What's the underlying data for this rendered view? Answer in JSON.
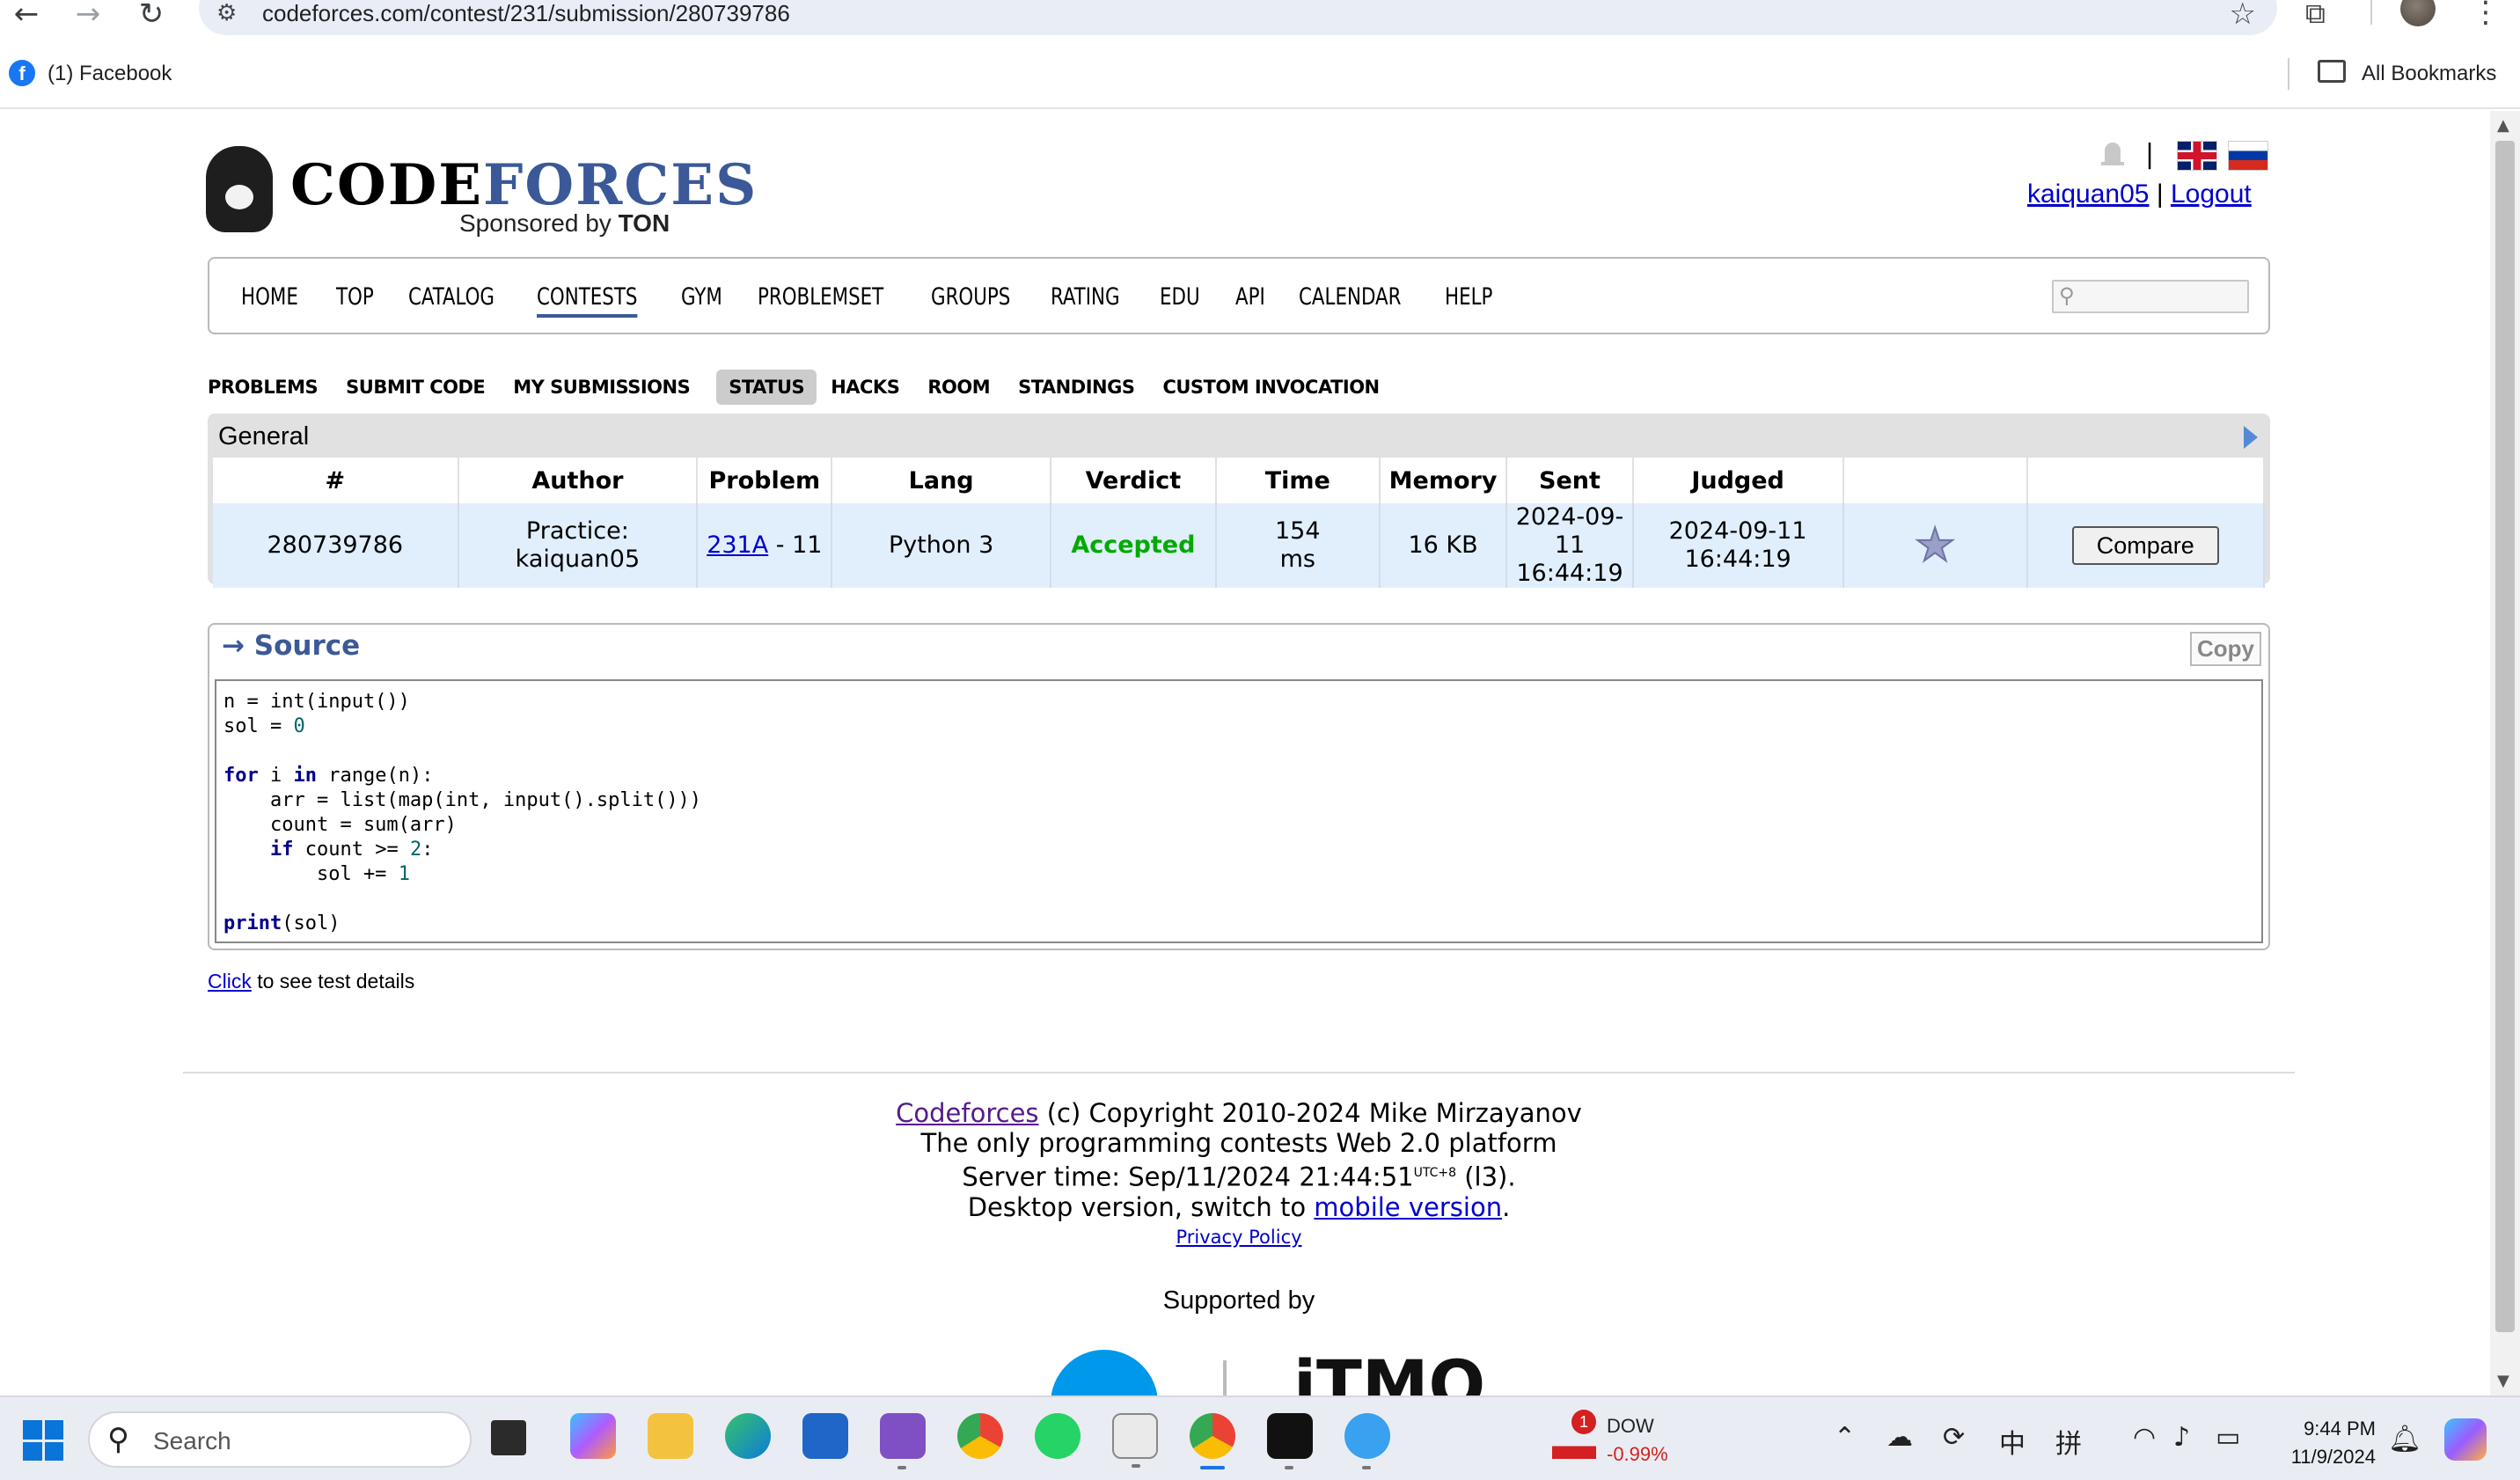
{
  "browser": {
    "url": "codeforces.com/contest/231/submission/280739786",
    "bookmark_label": "(1) Facebook",
    "all_bookmarks": "All Bookmarks"
  },
  "header": {
    "logo_code": "CODE",
    "logo_forces": "FORCES",
    "sponsored_prefix": "Sponsored by",
    "sponsored_brand": "TON",
    "username": "kaiquan05",
    "separator": "|",
    "logout": "Logout"
  },
  "main_menu": [
    "HOME",
    "TOP",
    "CATALOG",
    "CONTESTS",
    "GYM",
    "PROBLEMSET",
    "GROUPS",
    "RATING",
    "EDU",
    "API",
    "CALENDAR",
    "HELP"
  ],
  "main_menu_active": "CONTESTS",
  "second_menu": [
    "PROBLEMS",
    "SUBMIT CODE",
    "MY SUBMISSIONS",
    "STATUS",
    "HACKS",
    "ROOM",
    "STANDINGS",
    "CUSTOM INVOCATION"
  ],
  "second_menu_active": "STATUS",
  "status": {
    "title": "General",
    "columns": [
      "#",
      "Author",
      "Problem",
      "Lang",
      "Verdict",
      "Time",
      "Memory",
      "Sent",
      "Judged",
      "",
      ""
    ],
    "row": {
      "id": "280739786",
      "author_line1": "Practice:",
      "author_line2": "kaiquan05",
      "problem_link": "231A",
      "problem_suffix": " - 11",
      "lang": "Python 3",
      "verdict": "Accepted",
      "time_line1": "154",
      "time_line2": "ms",
      "memory": "16 KB",
      "sent_date": "2024-09-11",
      "sent_time": "16:44:19",
      "judged_date": "2024-09-11",
      "judged_time": "16:44:19",
      "favourite_icon": "star-icon",
      "compare": "Compare"
    }
  },
  "source": {
    "title": "→ Source",
    "copy": "Copy",
    "code": [
      "n = int(input())",
      "sol = 0",
      "",
      "for i in range(n):",
      "    arr = list(map(int, input().split()))",
      "    count = sum(arr)",
      "    if count >= 2:",
      "        sol += 1",
      "",
      "print(sol)"
    ]
  },
  "test_details": {
    "link": "Click",
    "text": " to see test details"
  },
  "footer": {
    "codeforces_link": "Codeforces",
    "copyright": " (c) Copyright 2010-2024 Mike Mirzayanov",
    "line2": "The only programming contests Web 2.0 platform",
    "server_time_prefix": "Server time: Sep/11/2024 21:44:51",
    "server_time_tz": "UTC+8",
    "server_time_suffix": " (l3).",
    "desktop_prefix": "Desktop version, switch to ",
    "mobile_link": "mobile version",
    "desktop_suffix": ".",
    "privacy": "Privacy Policy",
    "supported_by": "Supported by",
    "itmo": "iTMO"
  },
  "taskbar": {
    "search_label": "Search",
    "dow_label": "DOW",
    "dow_value": "-0.99%",
    "dow_badge": "1",
    "ime_chinese": "中",
    "ime_pinyin": "拼",
    "time": "9:44 PM",
    "date": "11/9/2024"
  },
  "colors": {
    "accent": "#3b5998",
    "link": "#0000cc",
    "accepted": "#00aa00",
    "row_bg": "#e1effd"
  }
}
